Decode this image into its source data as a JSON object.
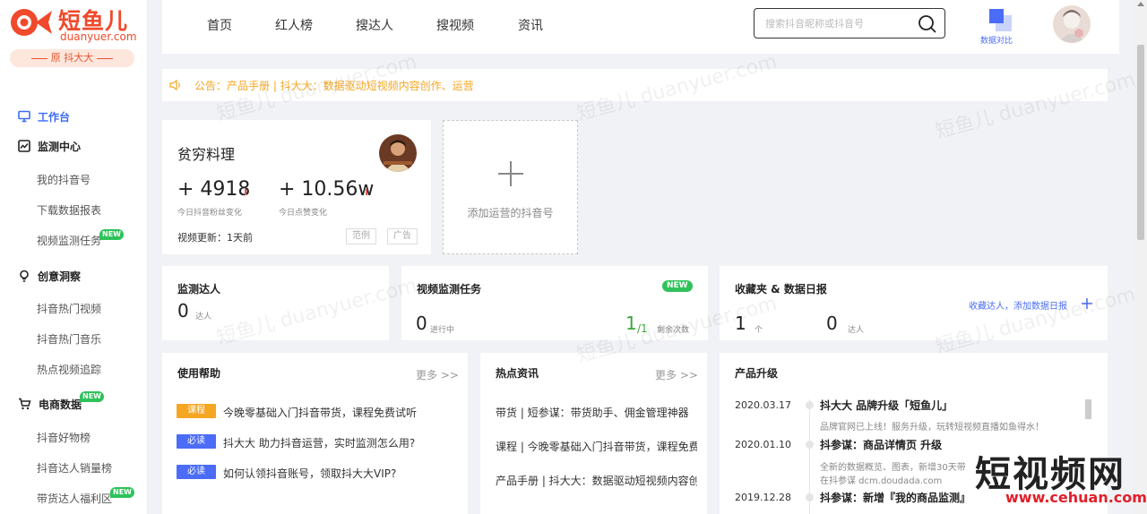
{
  "brand": {
    "name_cn": "短鱼儿",
    "name_en": "duanyuer.com",
    "origin": "原 抖大大"
  },
  "sidebar": {
    "sections": [
      {
        "label": "工作台",
        "icon": "monitor-icon",
        "active": true
      },
      {
        "label": "监测中心",
        "icon": "chart-line-icon",
        "items": [
          "我的抖音号",
          "下载数据报表",
          "视频监测任务"
        ]
      },
      {
        "label": "创意洞察",
        "icon": "lightbulb-icon",
        "items": [
          "抖音热门视频",
          "抖音热门音乐",
          "热点视频追踪"
        ]
      },
      {
        "label": "电商数据",
        "icon": "cart-icon",
        "items": [
          "抖音好物榜",
          "抖音达人销量榜",
          "带货达人福利区"
        ]
      }
    ],
    "new_badge": "NEW"
  },
  "topnav": {
    "items": [
      "首页",
      "红人榜",
      "搜达人",
      "搜视频",
      "资讯"
    ]
  },
  "search": {
    "placeholder": "搜索抖音昵称或抖音号",
    "value": ""
  },
  "compare": {
    "label": "数据对比"
  },
  "notice": {
    "text": "公告：产品手册 | 抖大大：数据驱动短视频内容创作、运营"
  },
  "account": {
    "name": "贫穷料理",
    "fans_change": "+ 4918",
    "fans_label": "今日抖音粉丝变化",
    "likes_change": "+ 10.56w",
    "likes_label": "今日点赞变化",
    "video_update": "视频更新：1天前",
    "btn_example": "范例",
    "btn_ad": "广告"
  },
  "add_account": {
    "label": "添加运营的抖音号"
  },
  "monitor": {
    "title": "监测达人",
    "count": "0",
    "unit": "达人"
  },
  "video_task": {
    "title": "视频监测任务",
    "badge": "NEW",
    "running": "0",
    "running_label": "进行中",
    "remaining": "1",
    "remaining_total": "/1",
    "remaining_label": "剩余次数"
  },
  "favorites": {
    "title": "收藏夹 & 数据日报",
    "link": "收藏达人，添加数据日报",
    "count1": "1",
    "unit1": "个",
    "count2": "0",
    "unit2": "达人"
  },
  "help": {
    "title": "使用帮助",
    "more": "更多 >>",
    "items": [
      {
        "tag": "课程",
        "tag_color": "#f5a623",
        "text": "今晚零基础入门抖音带货，课程免费试听"
      },
      {
        "tag": "必读",
        "tag_color": "#4a6cf7",
        "text": "抖大大 助力抖音运营，实时监测怎么用?"
      },
      {
        "tag": "必读",
        "tag_color": "#4a6cf7",
        "text": "如何认领抖音账号，领取抖大大VIP?"
      }
    ]
  },
  "hot_news": {
    "title": "热点资讯",
    "more": "更多 >>",
    "items": [
      "带货 | 短参谋：带货助手、佣金管理神器",
      "课程 | 今晚零基础入门抖音带货，课程免费",
      "产品手册 | 抖大大：数据驱动短视频内容创"
    ]
  },
  "upgrade": {
    "title": "产品升级",
    "items": [
      {
        "date": "2020.03.17",
        "title": "抖大大 品牌升级「短鱼儿」",
        "desc": "品牌官网已上线！服务升级，玩转短视频直播如鱼得水！"
      },
      {
        "date": "2020.01.10",
        "title": "抖参谋：商品详情页 升级",
        "desc": "全新的数据概览、图表，新增30天带",
        "desc2": "在抖参谋 dcm.doudada.com"
      },
      {
        "date": "2019.12.28",
        "title": "抖参谋：新增『我的商品监测』"
      }
    ]
  },
  "watermark": {
    "text": "短鱼儿 duanyuer.com",
    "brand_cn": "短视频网",
    "brand_url": "www.cehuan.com"
  },
  "colors": {
    "accent": "#3d6cf5",
    "brand": "#f0492c",
    "notice": "#f5a623",
    "new_badge": "#2fc25b",
    "green": "#3aa53a"
  }
}
